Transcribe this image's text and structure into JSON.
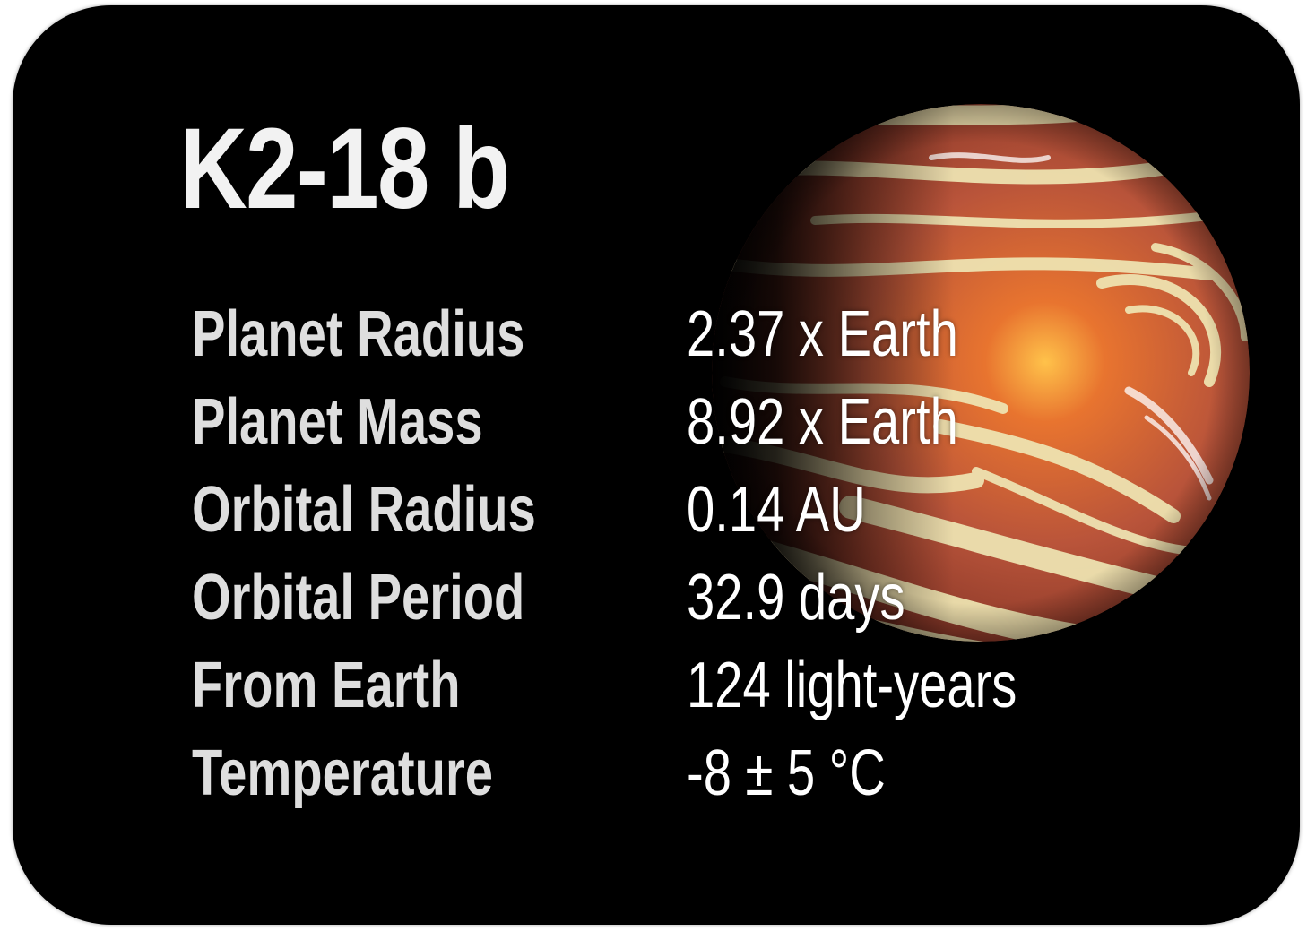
{
  "planet_name": "K2-18 b",
  "facts": [
    {
      "label": "Planet Radius",
      "value": "2.37 x Earth"
    },
    {
      "label": "Planet Mass",
      "value": "8.92 x Earth"
    },
    {
      "label": "Orbital Radius",
      "value": "0.14 AU"
    },
    {
      "label": "Orbital Period",
      "value": "32.9 days"
    },
    {
      "label": "From Earth",
      "value": "124 light-years"
    },
    {
      "label": "Temperature",
      "value": "-8 ± 5 °C"
    }
  ],
  "colors": {
    "card_background": "#000000",
    "title_text": "#f2f2f2",
    "label_text": "#dedede",
    "value_text": "#ffffff",
    "planet_base": "#b85a3c",
    "planet_bands": "#efe6b4"
  },
  "icons": {
    "planet_image": "planet-illustration"
  }
}
